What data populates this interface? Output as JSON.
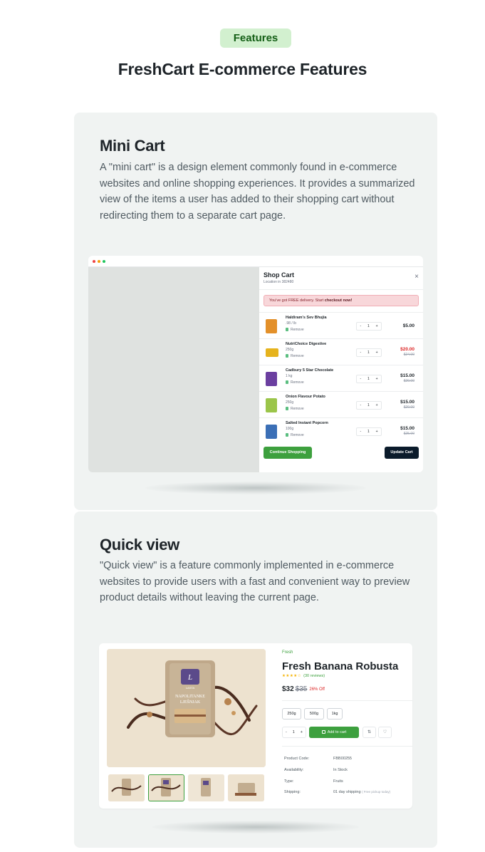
{
  "header": {
    "badge": "Features",
    "title": "FreshCart E-commerce Features"
  },
  "mini_cart": {
    "heading": "Mini Cart",
    "description": "A \"mini cart\" is a design element commonly found in e-commerce websites and online shopping experiences. It provides a summarized view of the items a user has added to their shopping cart without redirecting them to a separate cart page.",
    "drawer": {
      "title": "Shop Cart",
      "location": "Location in 382480",
      "close": "×",
      "alert_text": "You've got FREE delivery. Start ",
      "alert_link": "checkout now!",
      "items": [
        {
          "name": "Haldiram's Sev Bhujia",
          "weight": ".98 / lb",
          "remove": "Remove",
          "qty": "1",
          "price": "$5.00",
          "old_price": "",
          "color": "#e3902a"
        },
        {
          "name": "NutriChoice Digestive",
          "weight": "250g",
          "remove": "Remove",
          "qty": "1",
          "price": "$20.00",
          "old_price": "$24.00",
          "color": "#e6b31d"
        },
        {
          "name": "Cadbury 5 Star Chocolate",
          "weight": "1 kg",
          "remove": "Remove",
          "qty": "1",
          "price": "$15.00",
          "old_price": "$20.00",
          "color": "#6b3fa0"
        },
        {
          "name": "Onion Flavour Potato",
          "weight": "250g",
          "remove": "Remove",
          "qty": "1",
          "price": "$15.00",
          "old_price": "$20.00",
          "color": "#9bc54a"
        },
        {
          "name": "Salted Instant Popcorn",
          "weight": "100g",
          "remove": "Remove",
          "qty": "1",
          "price": "$15.00",
          "old_price": "$25.00",
          "color": "#3b6fb6"
        }
      ],
      "continue_button": "Continue Shopping",
      "update_button": "Update Cart"
    }
  },
  "quick_view": {
    "heading": "Quick view",
    "description": "\"Quick view\" is a feature commonly implemented in e-commerce websites to provide users with a fast and convenient way to preview product details without leaving the current page.",
    "product": {
      "category": "Fresh",
      "name": "Fresh Banana Robusta",
      "stars": "★★★★☆",
      "reviews": "(30 reviews)",
      "price": "$32",
      "old_price": "$35",
      "discount": "26% Off",
      "package_brand": "LASTA",
      "package_name": "NAPOLITANKE LJEŠNJAK",
      "sizes": [
        "250g",
        "500g",
        "1kg"
      ],
      "qty": "1",
      "add_to_cart": "Add to cart",
      "compare_icon": "⇅",
      "wishlist_icon": "♡",
      "details": [
        {
          "label": "Product Code:",
          "value": "FBB00255",
          "note": ""
        },
        {
          "label": "Availability:",
          "value": "In Stock",
          "note": ""
        },
        {
          "label": "Type:",
          "value": "Fruits",
          "note": ""
        },
        {
          "label": "Shipping:",
          "value": "01 day shipping",
          "note": "( Free pickup today)"
        }
      ]
    }
  }
}
